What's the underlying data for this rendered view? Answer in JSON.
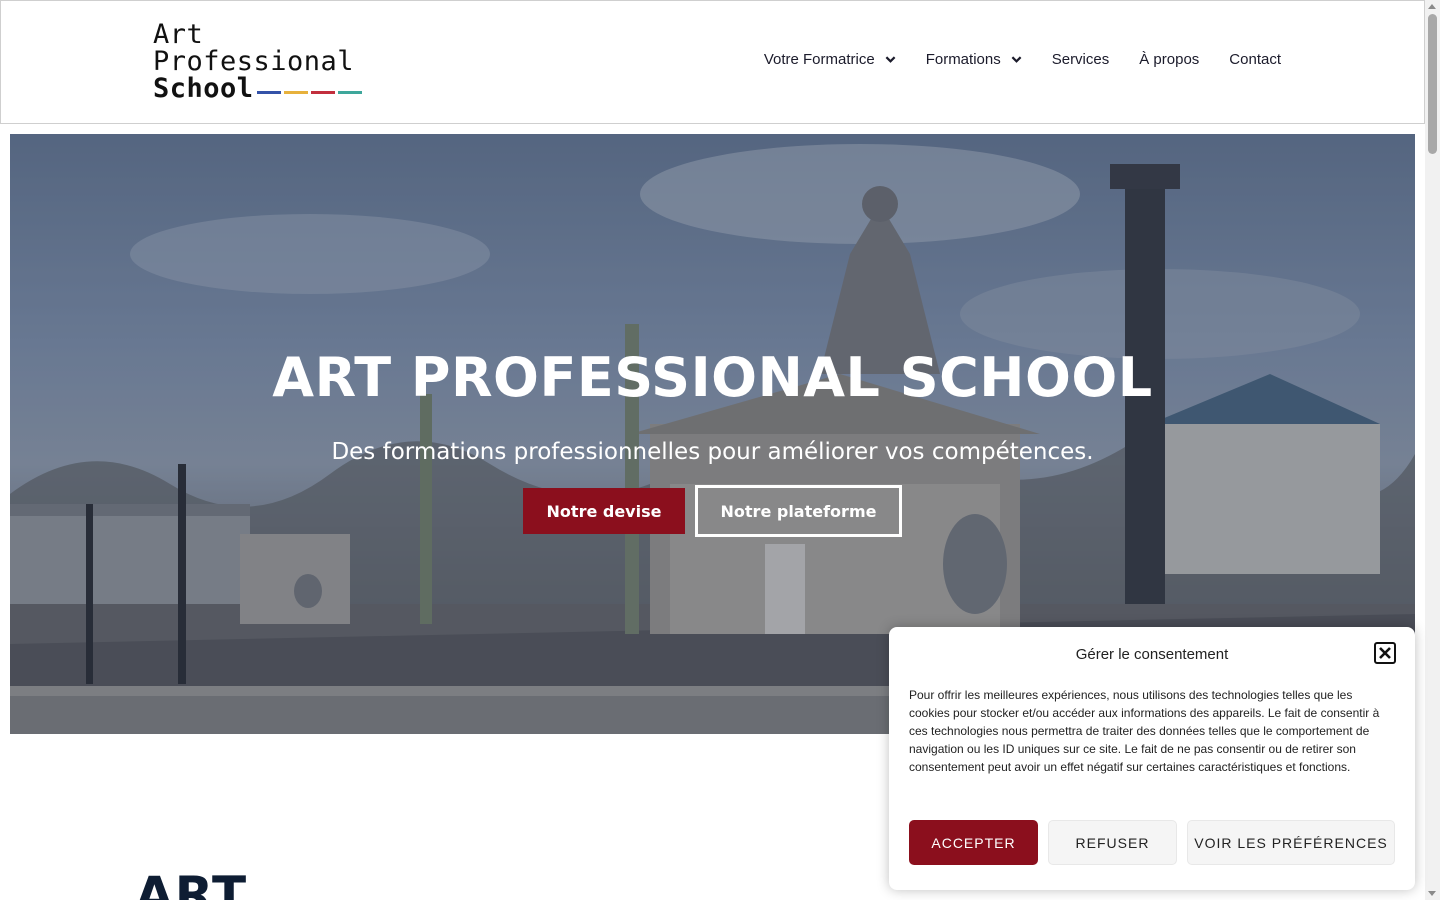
{
  "logo": {
    "line1": "Art",
    "line2": "Professional",
    "line3": "School",
    "bar_colors": [
      "#3452a8",
      "#e7b13c",
      "#c22f3d",
      "#3ea79b"
    ]
  },
  "nav": {
    "items": [
      {
        "label": "Votre Formatrice",
        "has_dropdown": true
      },
      {
        "label": "Formations",
        "has_dropdown": true
      },
      {
        "label": "Services",
        "has_dropdown": false
      },
      {
        "label": "À propos",
        "has_dropdown": false
      },
      {
        "label": "Contact",
        "has_dropdown": false
      }
    ]
  },
  "hero": {
    "title": "ART PROFESSIONAL SCHOOL",
    "subtitle": "Des formations professionnelles pour améliorer vos compétences.",
    "primary_button": "Notre devise",
    "secondary_button": "Notre plateforme"
  },
  "section": {
    "heading": "ART"
  },
  "consent": {
    "title": "Gérer le consentement",
    "body": "Pour offrir les meilleures expériences, nous utilisons des technologies telles que les cookies pour stocker et/ou accéder aux informations des appareils. Le fait de consentir à ces technologies nous permettra de traiter des données telles que le comportement de navigation ou les ID uniques sur ce site. Le fait de ne pas consentir ou de retirer son consentement peut avoir un effet négatif sur certaines caractéristiques et fonctions.",
    "accept": "ACCEPTER",
    "refuse": "REFUSER",
    "preferences": "VOIR LES PRÉFÉRENCES"
  },
  "colors": {
    "accent": "#8b0f1d",
    "text": "#1b1b2b",
    "heading": "#0e1d33"
  }
}
